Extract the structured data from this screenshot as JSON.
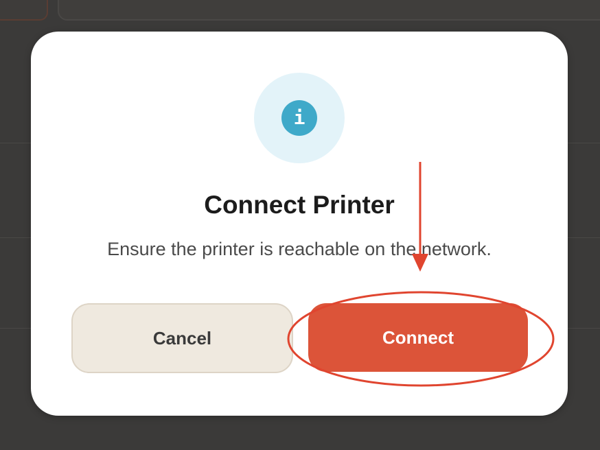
{
  "dialog": {
    "icon": "info-icon",
    "icon_glyph": "i",
    "title": "Connect Printer",
    "message": "Ensure the printer is reachable on the network.",
    "cancel_label": "Cancel",
    "confirm_label": "Connect"
  },
  "colors": {
    "backdrop": "#3b3a39",
    "dialog_bg": "#ffffff",
    "icon_circle_bg": "#e3f3f9",
    "icon_fg": "#3fa9c9",
    "primary": "#dc5439",
    "secondary_bg": "#efe9df",
    "annotation": "#e0452f"
  }
}
